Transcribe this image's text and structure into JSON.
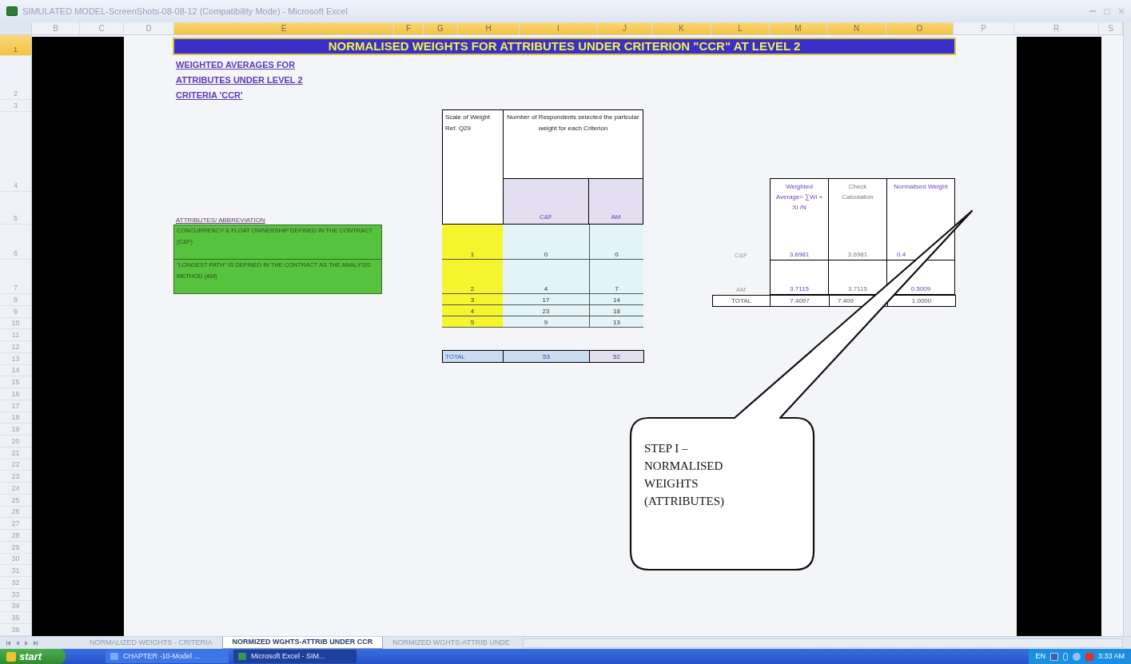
{
  "window": {
    "title": "SIMULATED MODEL-ScreenShots-08-08-12  (Compatibility Mode) - Microsoft Excel"
  },
  "columns": [
    {
      "label": "B",
      "selected": false
    },
    {
      "label": "C",
      "selected": false
    },
    {
      "label": "D",
      "selected": false
    },
    {
      "label": "E",
      "selected": true
    },
    {
      "label": "F",
      "selected": true
    },
    {
      "label": "G",
      "selected": true
    },
    {
      "label": "H",
      "selected": true
    },
    {
      "label": "I",
      "selected": true
    },
    {
      "label": "J",
      "selected": true
    },
    {
      "label": "K",
      "selected": true
    },
    {
      "label": "L",
      "selected": true
    },
    {
      "label": "M",
      "selected": true
    },
    {
      "label": "N",
      "selected": true
    },
    {
      "label": "O",
      "selected": true
    },
    {
      "label": "P",
      "selected": false
    },
    {
      "label": "R",
      "selected": false
    },
    {
      "label": "S",
      "selected": false
    }
  ],
  "rows": [
    {
      "label": "1",
      "selected": true
    },
    {
      "label": "2",
      "selected": false
    },
    {
      "label": "3",
      "selected": false
    },
    {
      "label": "4",
      "selected": false
    },
    {
      "label": "5",
      "selected": false
    },
    {
      "label": "6",
      "selected": false
    },
    {
      "label": "7",
      "selected": false
    },
    {
      "label": "8",
      "selected": false
    },
    {
      "label": "9",
      "selected": false
    },
    {
      "label": "10",
      "selected": false
    },
    {
      "label": "11",
      "selected": false
    },
    {
      "label": "12",
      "selected": false
    },
    {
      "label": "13",
      "selected": false
    },
    {
      "label": "14",
      "selected": false
    },
    {
      "label": "15",
      "selected": false
    },
    {
      "label": "16",
      "selected": false
    },
    {
      "label": "17",
      "selected": false
    },
    {
      "label": "18",
      "selected": false
    },
    {
      "label": "19",
      "selected": false
    },
    {
      "label": "20",
      "selected": false
    },
    {
      "label": "21",
      "selected": false
    },
    {
      "label": "22",
      "selected": false
    },
    {
      "label": "23",
      "selected": false
    },
    {
      "label": "24",
      "selected": false
    },
    {
      "label": "25",
      "selected": false
    },
    {
      "label": "26",
      "selected": false
    },
    {
      "label": "27",
      "selected": false
    },
    {
      "label": "28",
      "selected": false
    },
    {
      "label": "29",
      "selected": false
    },
    {
      "label": "30",
      "selected": false
    },
    {
      "label": "31",
      "selected": false
    },
    {
      "label": "32",
      "selected": false
    },
    {
      "label": "33",
      "selected": false
    },
    {
      "label": "34",
      "selected": false
    },
    {
      "label": "35",
      "selected": false
    },
    {
      "label": "36",
      "selected": false
    }
  ],
  "banner": {
    "text": "NORMALISED WEIGHTS FOR ATTRIBUTES UNDER CRITERION \"CCR\" AT LEVEL 2"
  },
  "heading_lines": [
    "WEIGHTED AVERAGES FOR",
    "ATTRIBUTES UNDER  LEVEL 2",
    "CRITERIA 'CCR'"
  ],
  "attributes": {
    "heading": "ATTRIBUTES/ ABBREVIATION",
    "items": [
      "CONCURRENCY & FLOAT OWNERSHIP DEFINED IN THE CONTRACT (C&F)",
      "\"LONGEST PATH\" IS DEFINED IN THE CONTRACT AS THE ANALYSIS METHOD (AM)"
    ]
  },
  "respondents_table": {
    "scale_header": "Scale of Weight Ref. Q29",
    "group_header": "Number of Respondents selected the partcular weight for each Criterion",
    "columns": [
      "C&F",
      "AM"
    ],
    "rows": [
      {
        "scale": "1",
        "values": [
          "0",
          "0"
        ]
      },
      {
        "scale": "2",
        "values": [
          "4",
          "7"
        ]
      },
      {
        "scale": "3",
        "values": [
          "17",
          "14"
        ]
      },
      {
        "scale": "4",
        "values": [
          "23",
          "18"
        ]
      },
      {
        "scale": "5",
        "values": [
          "9",
          "13"
        ]
      }
    ],
    "total": {
      "label": "TOTAL",
      "values": [
        "53",
        "52"
      ]
    }
  },
  "weights_table": {
    "headers": [
      "Weighted Average= ∑Wi × Xi /N",
      "Check Calculation",
      "Normalised Weight"
    ],
    "rows": [
      {
        "label": "C&F",
        "values": [
          "3.6981",
          "3.6981",
          "0.4"
        ]
      },
      {
        "label": "AM",
        "values": [
          "3.7115",
          "3.7115",
          "0.5009"
        ]
      }
    ],
    "total": {
      "label": "TOTAL",
      "values": [
        "7.4097",
        "7.409",
        "1.0000"
      ]
    }
  },
  "callout": {
    "text": "STEP I – NORMALISED WEIGHTS (ATTRIBUTES)"
  },
  "sheet_tabs": [
    {
      "label": "NORMALIZED WEIGHTS - CRITERIA",
      "selected": false
    },
    {
      "label": "NORMIZED WGHTS-ATTRIB UNDER CCR",
      "selected": true
    },
    {
      "label": "NORMIZED WGHTS-ATTRIB UNDE",
      "selected": false
    }
  ],
  "taskbar": {
    "start": "start",
    "buttons": [
      {
        "label": "CHAPTER -10-Model ...",
        "selected": false
      },
      {
        "label": "Microsoft Excel - SIM...",
        "selected": true
      }
    ],
    "language": "EN",
    "clock": "3:33 AM"
  }
}
